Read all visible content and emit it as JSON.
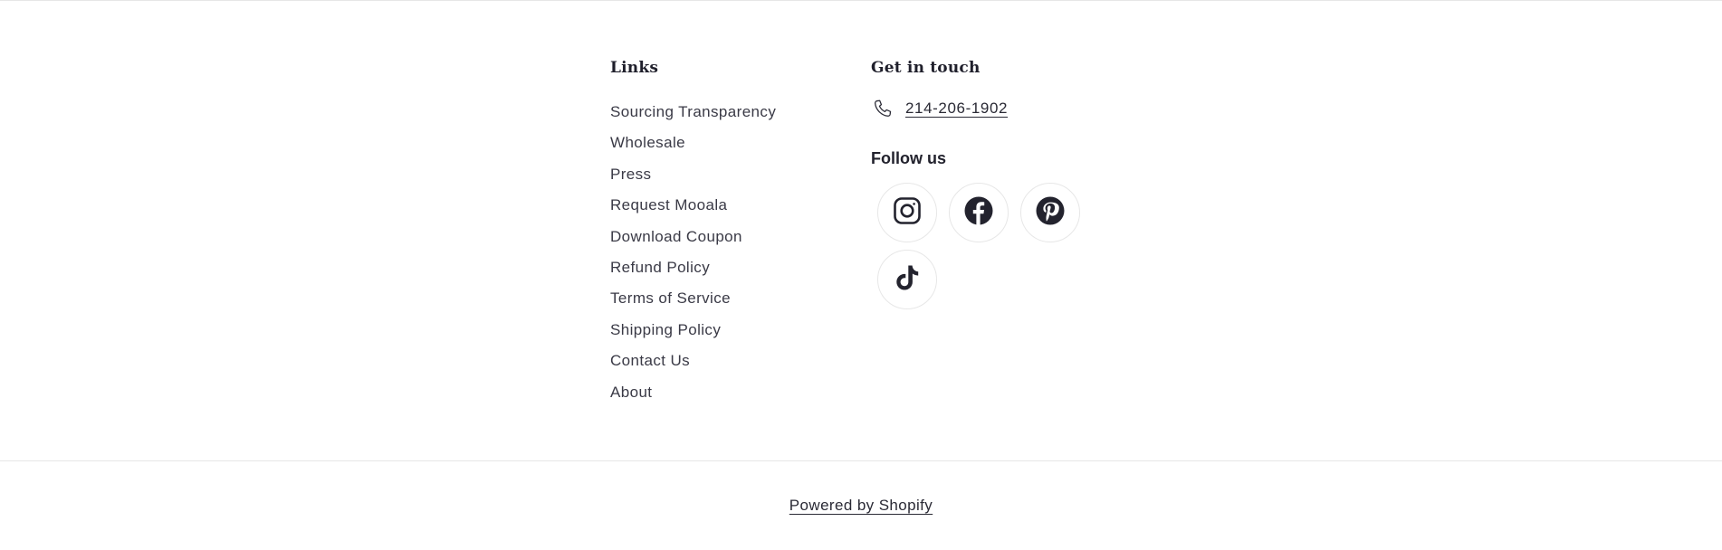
{
  "footer": {
    "links_heading": "Links",
    "links": [
      {
        "label": "Sourcing Transparency"
      },
      {
        "label": "Wholesale"
      },
      {
        "label": "Press"
      },
      {
        "label": "Request Mooala"
      },
      {
        "label": "Download Coupon"
      },
      {
        "label": "Refund Policy"
      },
      {
        "label": "Terms of Service"
      },
      {
        "label": "Shipping Policy"
      },
      {
        "label": "Contact Us"
      },
      {
        "label": "About"
      }
    ],
    "contact_heading": "Get in touch",
    "phone": {
      "icon": "phone-icon",
      "number": "214-206-1902"
    },
    "follow_heading": "Follow us",
    "social": [
      {
        "icon": "instagram-icon"
      },
      {
        "icon": "facebook-icon"
      },
      {
        "icon": "pinterest-icon"
      },
      {
        "icon": "tiktok-icon"
      }
    ],
    "powered_by": "Powered by Shopify"
  },
  "colors": {
    "text": "#2a2a35",
    "border": "#e6e6e6",
    "background": "#ffffff"
  }
}
